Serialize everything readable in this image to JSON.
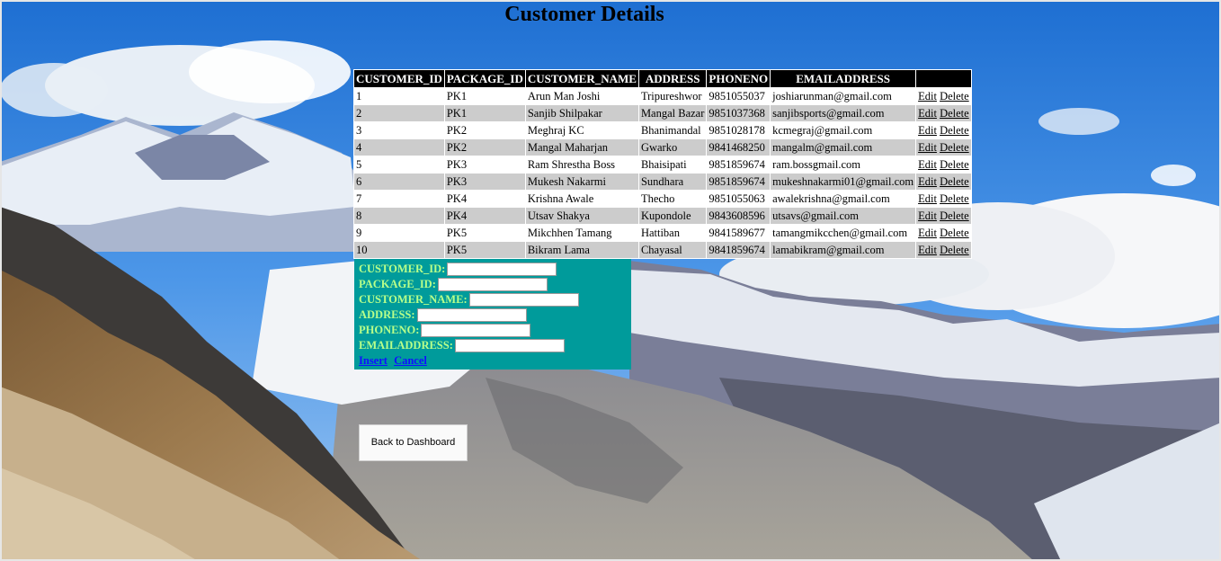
{
  "page": {
    "title": "Customer Details"
  },
  "table": {
    "headers": [
      "CUSTOMER_ID",
      "PACKAGE_ID",
      "CUSTOMER_NAME",
      "ADDRESS",
      "PHONENO",
      "EMAILADDRESS",
      ""
    ],
    "edit_label": "Edit",
    "delete_label": "Delete",
    "rows": [
      [
        "1",
        "PK1",
        "Arun Man Joshi",
        "Tripureshwor",
        "9851055037",
        "joshiarunman@gmail.com"
      ],
      [
        "2",
        "PK1",
        "Sanjib Shilpakar",
        "Mangal Bazar",
        "9851037368",
        "sanjibsports@gmail.com"
      ],
      [
        "3",
        "PK2",
        "Meghraj KC",
        "Bhanimandal",
        "9851028178",
        "kcmegraj@gmail.com"
      ],
      [
        "4",
        "PK2",
        "Mangal Maharjan",
        "Gwarko",
        "9841468250",
        "mangalm@gmail.com"
      ],
      [
        "5",
        "PK3",
        "Ram Shrestha Boss",
        "Bhaisipati",
        "9851859674",
        "ram.bossgmail.com"
      ],
      [
        "6",
        "PK3",
        "Mukesh Nakarmi",
        "Sundhara",
        "9851859674",
        "mukeshnakarmi01@gmail.com"
      ],
      [
        "7",
        "PK4",
        "Krishna Awale",
        "Thecho",
        "9851055063",
        "awalekrishna@gmail.com"
      ],
      [
        "8",
        "PK4",
        "Utsav Shakya",
        "Kupondole",
        "9843608596",
        "utsavs@gmail.com"
      ],
      [
        "9",
        "PK5",
        "Mikchhen Tamang",
        "Hattiban",
        "9841589677",
        "tamangmikcchen@gmail.com"
      ],
      [
        "10",
        "PK5",
        "Bikram Lama",
        "Chayasal",
        "9841859674",
        "lamabikram@gmail.com"
      ]
    ]
  },
  "form": {
    "fields": [
      {
        "label": "CUSTOMER_ID:",
        "value": ""
      },
      {
        "label": "PACKAGE_ID:",
        "value": ""
      },
      {
        "label": "CUSTOMER_NAME:",
        "value": ""
      },
      {
        "label": "ADDRESS:",
        "value": ""
      },
      {
        "label": "PHONENO:",
        "value": ""
      },
      {
        "label": "EMAILADDRESS:",
        "value": ""
      }
    ],
    "insert_label": "Insert",
    "cancel_label": "Cancel"
  },
  "back_button": "Back to Dashboard",
  "colors": {
    "form_bg": "#009b9b",
    "form_label": "#b8ff8a",
    "header_bg": "#000000",
    "alt_row": "#cccccc"
  }
}
